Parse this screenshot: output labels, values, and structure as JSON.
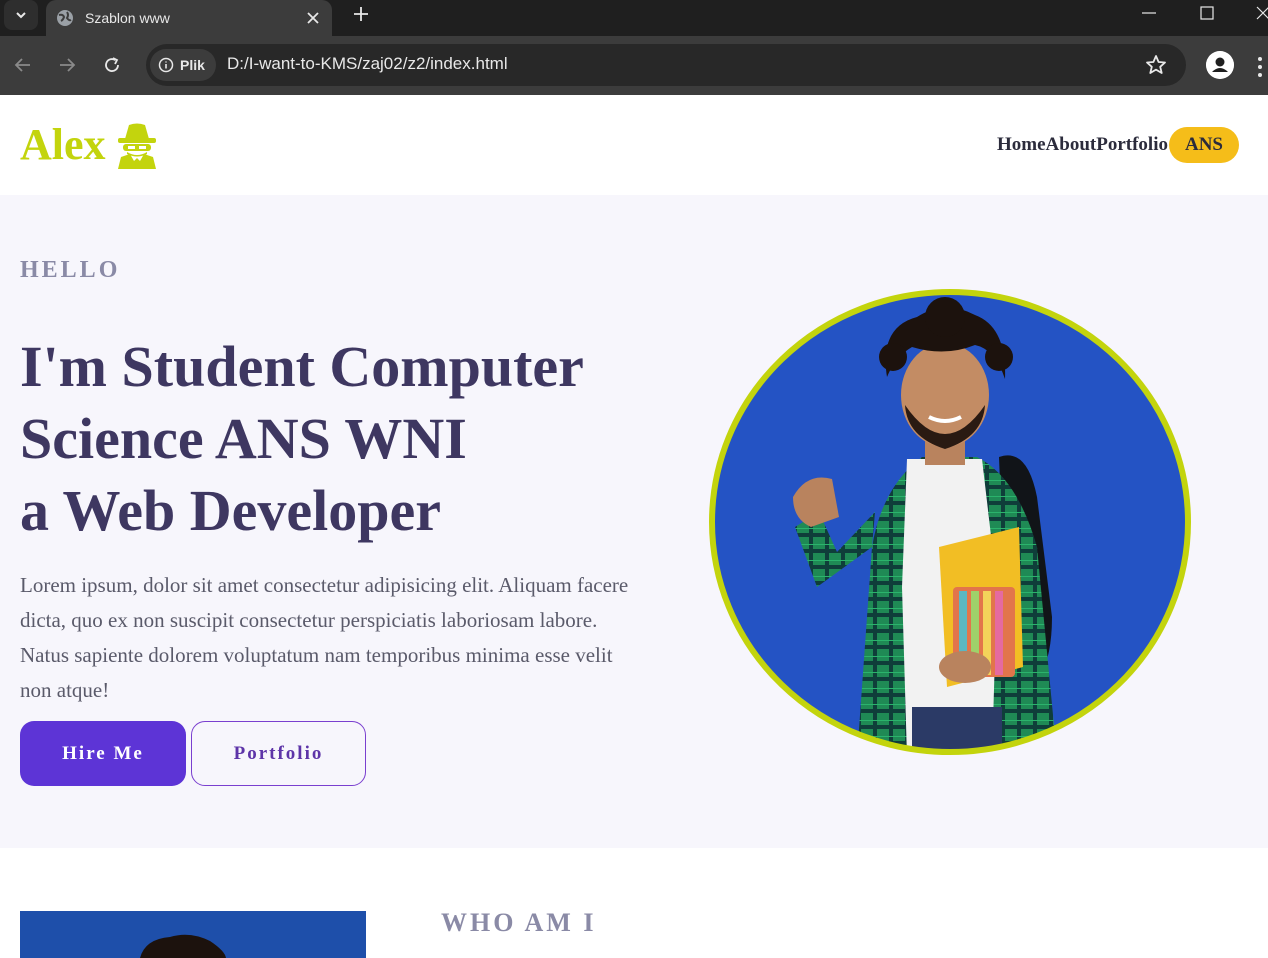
{
  "browser": {
    "tab_title": "Szablon www",
    "security_chip": "Plik",
    "url": "D:/I-want-to-KMS/zaj02/z2/index.html"
  },
  "header": {
    "logo_text": "Alex",
    "logo_icon": "spy-icon",
    "nav": [
      {
        "label": "Home"
      },
      {
        "label": "About"
      },
      {
        "label": "Portfolio"
      }
    ],
    "badge": "ANS"
  },
  "hero": {
    "eyebrow": "HELLO",
    "headline": {
      "prefix": "I'm ",
      "bold_1": "Student Computer Science ANS WNI",
      "bold_2": "a",
      "suffix": " Web Developer"
    },
    "lead": "Lorem ipsum, dolor sit amet consectetur adipisicing elit. Aliquam facere dicta, quo ex non suscipit consectetur perspiciatis laboriosam labore. Natus sapiente dolorem voluptatum nam temporibus minima esse velit non atque!",
    "primary_button": "Hire Me",
    "secondary_button": "Portfolio"
  },
  "about": {
    "heading": "WHO AM I"
  },
  "colors": {
    "brand": "#c3d40d",
    "badge": "#f5bd19",
    "primary": "#5d34d6",
    "heading": "#3e3761",
    "hero_bg": "#f7f6fc"
  }
}
